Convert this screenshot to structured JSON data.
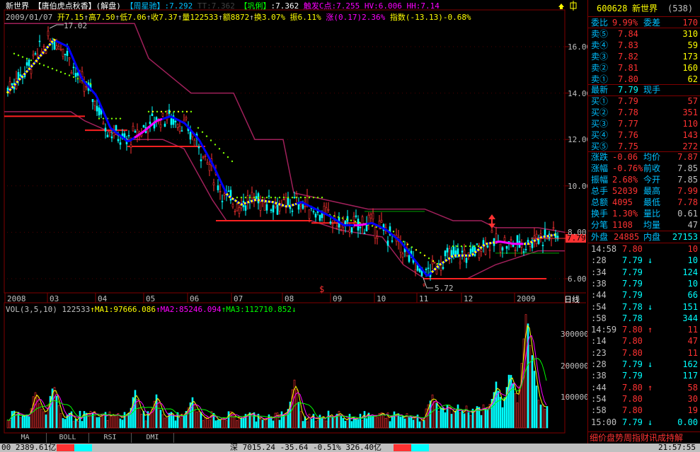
{
  "header": {
    "stock_name": "新世界",
    "indicator": "【唐伯虎点秋香】(解盘)",
    "weekly": "【周星驰】",
    "weekly_val": ":7.292",
    "tt": "TT:7.362",
    "hold": "【巩俐】",
    "hold_val": ":7.362",
    "trigger": "触发C点:7.255",
    "hv": "HV:6.006",
    "hh": "HH:7.14"
  },
  "ohlc_line": {
    "date": "2009/01/07",
    "open": "开7.15",
    "high": "高7.50",
    "low": "低7.06",
    "close": "收7.37",
    "volume": "量122533",
    "amount": "额8872",
    "turnover": "换3.07%",
    "amplitude": "振6.11%",
    "change": "涨(0.17)2.36%",
    "index": "指数(-13.13)-0.68%"
  },
  "chart_annotations": {
    "high_mark": "17.02",
    "low_mark": "5.72",
    "cur_price": "7.79",
    "dollar_mark": "$"
  },
  "y_ticks": [
    "16.00",
    "14.00",
    "12.00",
    "10.00",
    "8.00",
    "6.00"
  ],
  "x_ticks": [
    "2008",
    "03",
    "04",
    "05",
    "06",
    "07",
    "08",
    "09",
    "10",
    "11",
    "12",
    "2009"
  ],
  "period_label": "日线",
  "vol_header": {
    "vol": "VOL(3,5,10) 122533",
    "ma1": "MA1:97666.086",
    "ma2": "MA2:85246.094",
    "ma3": "MA3:112710.852"
  },
  "vol_ticks": [
    "300000",
    "200000",
    "100000"
  ],
  "tabs": [
    "MA",
    "BOLL",
    "RSI",
    "DMI"
  ],
  "bottom_bar": {
    "left": "00 2389.61亿",
    "mid": "深 7015.24 -35.64 -0.51% 326.40亿",
    "right": "21:57:55"
  },
  "quote_panel": {
    "code": "600628",
    "name": "新世界",
    "rank": "(538)",
    "weibi_label": "委比",
    "weibi_val": "9.99%",
    "weicha_label": "委差",
    "weicha_val": "170",
    "sells": [
      {
        "label": "卖⑤",
        "price": "7.84",
        "vol": "310"
      },
      {
        "label": "卖④",
        "price": "7.83",
        "vol": "59"
      },
      {
        "label": "卖③",
        "price": "7.82",
        "vol": "173"
      },
      {
        "label": "卖②",
        "price": "7.81",
        "vol": "160"
      },
      {
        "label": "卖①",
        "price": "7.80",
        "vol": "62"
      }
    ],
    "latest_label": "最新",
    "latest_val": "7.79",
    "xianshou_label": "现手",
    "buys": [
      {
        "label": "买①",
        "price": "7.79",
        "vol": "57"
      },
      {
        "label": "买②",
        "price": "7.78",
        "vol": "351"
      },
      {
        "label": "买③",
        "price": "7.77",
        "vol": "110"
      },
      {
        "label": "买④",
        "price": "7.76",
        "vol": "143"
      },
      {
        "label": "买⑤",
        "price": "7.75",
        "vol": "272"
      }
    ],
    "stats": [
      {
        "l1": "涨跌",
        "v1": "-0.06",
        "l2": "均价",
        "v2": "7.87"
      },
      {
        "l1": "涨幅",
        "v1": "-0.76%",
        "l2": "前收",
        "v2": "7.85"
      },
      {
        "l1": "振幅",
        "v1": "2.68%",
        "l2": "今开",
        "v2": "7.85"
      },
      {
        "l1": "总手",
        "v1": "52039",
        "l2": "最高",
        "v2": "7.99"
      },
      {
        "l1": "总额",
        "v1": "4095",
        "l2": "最低",
        "v2": "7.78"
      },
      {
        "l1": "换手",
        "v1": "1.30%",
        "l2": "量比",
        "v2": "0.61"
      },
      {
        "l1": "分笔",
        "v1": "1108",
        "l2": "均量",
        "v2": "47"
      }
    ],
    "outer_label": "外盘",
    "outer_val": "24885",
    "inner_label": "内盘",
    "inner_val": "27153",
    "ticks": [
      {
        "t": "14:58",
        "p": "7.80",
        "a": "",
        "v": "10"
      },
      {
        "t": ":28",
        "p": "7.79",
        "a": "↓",
        "v": "10"
      },
      {
        "t": ":34",
        "p": "7.79",
        "a": "",
        "v": "124"
      },
      {
        "t": ":38",
        "p": "7.79",
        "a": "",
        "v": "10"
      },
      {
        "t": ":44",
        "p": "7.79",
        "a": "",
        "v": "66"
      },
      {
        "t": ":54",
        "p": "7.78",
        "a": "↓",
        "v": "151"
      },
      {
        "t": ":58",
        "p": "7.78",
        "a": "",
        "v": "344"
      },
      {
        "t": "14:59",
        "p": "7.80",
        "a": "↑",
        "v": "11"
      },
      {
        "t": ":14",
        "p": "7.80",
        "a": "",
        "v": "47"
      },
      {
        "t": ":23",
        "p": "7.80",
        "a": "",
        "v": "11"
      },
      {
        "t": ":28",
        "p": "7.79",
        "a": "↓",
        "v": "162"
      },
      {
        "t": ":38",
        "p": "7.79",
        "a": "",
        "v": "117"
      },
      {
        "t": ":44",
        "p": "7.80",
        "a": "↑",
        "v": "58"
      },
      {
        "t": ":54",
        "p": "7.80",
        "a": "",
        "v": "30"
      },
      {
        "t": ":58",
        "p": "7.80",
        "a": "",
        "v": "19"
      },
      {
        "t": "15:00",
        "p": "7.79",
        "a": "↓",
        "v": "0.00"
      }
    ],
    "bottom_tabs": "细价盘势周指财讯成持解"
  },
  "colors": {
    "up": "#ff3232",
    "down": "#00ffff",
    "label": "#00c0ff",
    "yellow": "#ffff00",
    "magenta": "#ff00ff",
    "green": "#00ff00",
    "grid": "#800000"
  }
}
